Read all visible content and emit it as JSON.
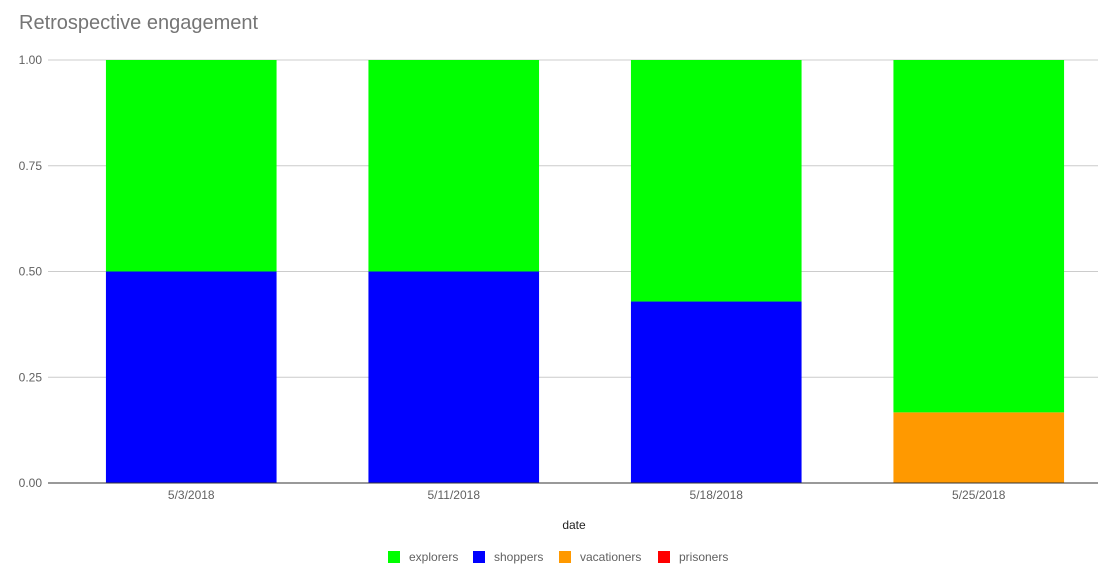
{
  "chart_data": {
    "type": "bar",
    "stacked": true,
    "title": "Retrospective engagement",
    "xlabel": "date",
    "ylabel": "",
    "ylim": [
      0,
      1
    ],
    "yticks": [
      "0.00",
      "0.25",
      "0.50",
      "0.75",
      "1.00"
    ],
    "ytick_values": [
      0,
      0.25,
      0.5,
      0.75,
      1.0
    ],
    "grid": true,
    "legend_position": "bottom",
    "categories": [
      "5/3/2018",
      "5/11/2018",
      "5/18/2018",
      "5/25/2018"
    ],
    "series": [
      {
        "name": "explorers",
        "color": "#00ff00",
        "values": [
          0.5,
          0.5,
          0.571,
          0.833
        ]
      },
      {
        "name": "shoppers",
        "color": "#0000ff",
        "values": [
          0.5,
          0.5,
          0.429,
          0
        ]
      },
      {
        "name": "vacationers",
        "color": "#ff9900",
        "values": [
          0,
          0,
          0,
          0.167
        ]
      },
      {
        "name": "prisoners",
        "color": "#ff0000",
        "values": [
          0,
          0,
          0,
          0
        ]
      }
    ],
    "stack_order_bottom_to_top": [
      "vacationers",
      "shoppers",
      "explorers",
      "prisoners"
    ]
  }
}
